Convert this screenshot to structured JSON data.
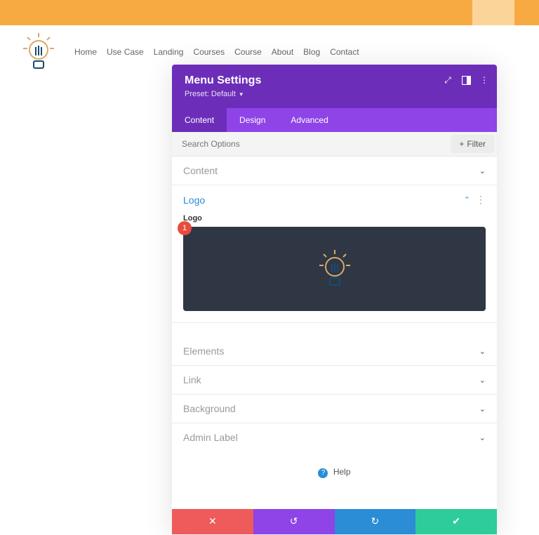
{
  "nav_items": [
    "Home",
    "Use Case",
    "Landing",
    "Courses",
    "Course",
    "About",
    "Blog",
    "Contact"
  ],
  "modal": {
    "title": "Menu Settings",
    "preset_label": "Preset: Default",
    "tabs": {
      "content": "Content",
      "design": "Design",
      "advanced": "Advanced"
    },
    "search_placeholder": "Search Options",
    "filter_label": "Filter",
    "sections": {
      "content": "Content",
      "logo": "Logo",
      "elements": "Elements",
      "link": "Link",
      "background": "Background",
      "admin_label": "Admin Label"
    },
    "logo_field_label": "Logo",
    "badge_number": "1",
    "help_label": "Help"
  }
}
